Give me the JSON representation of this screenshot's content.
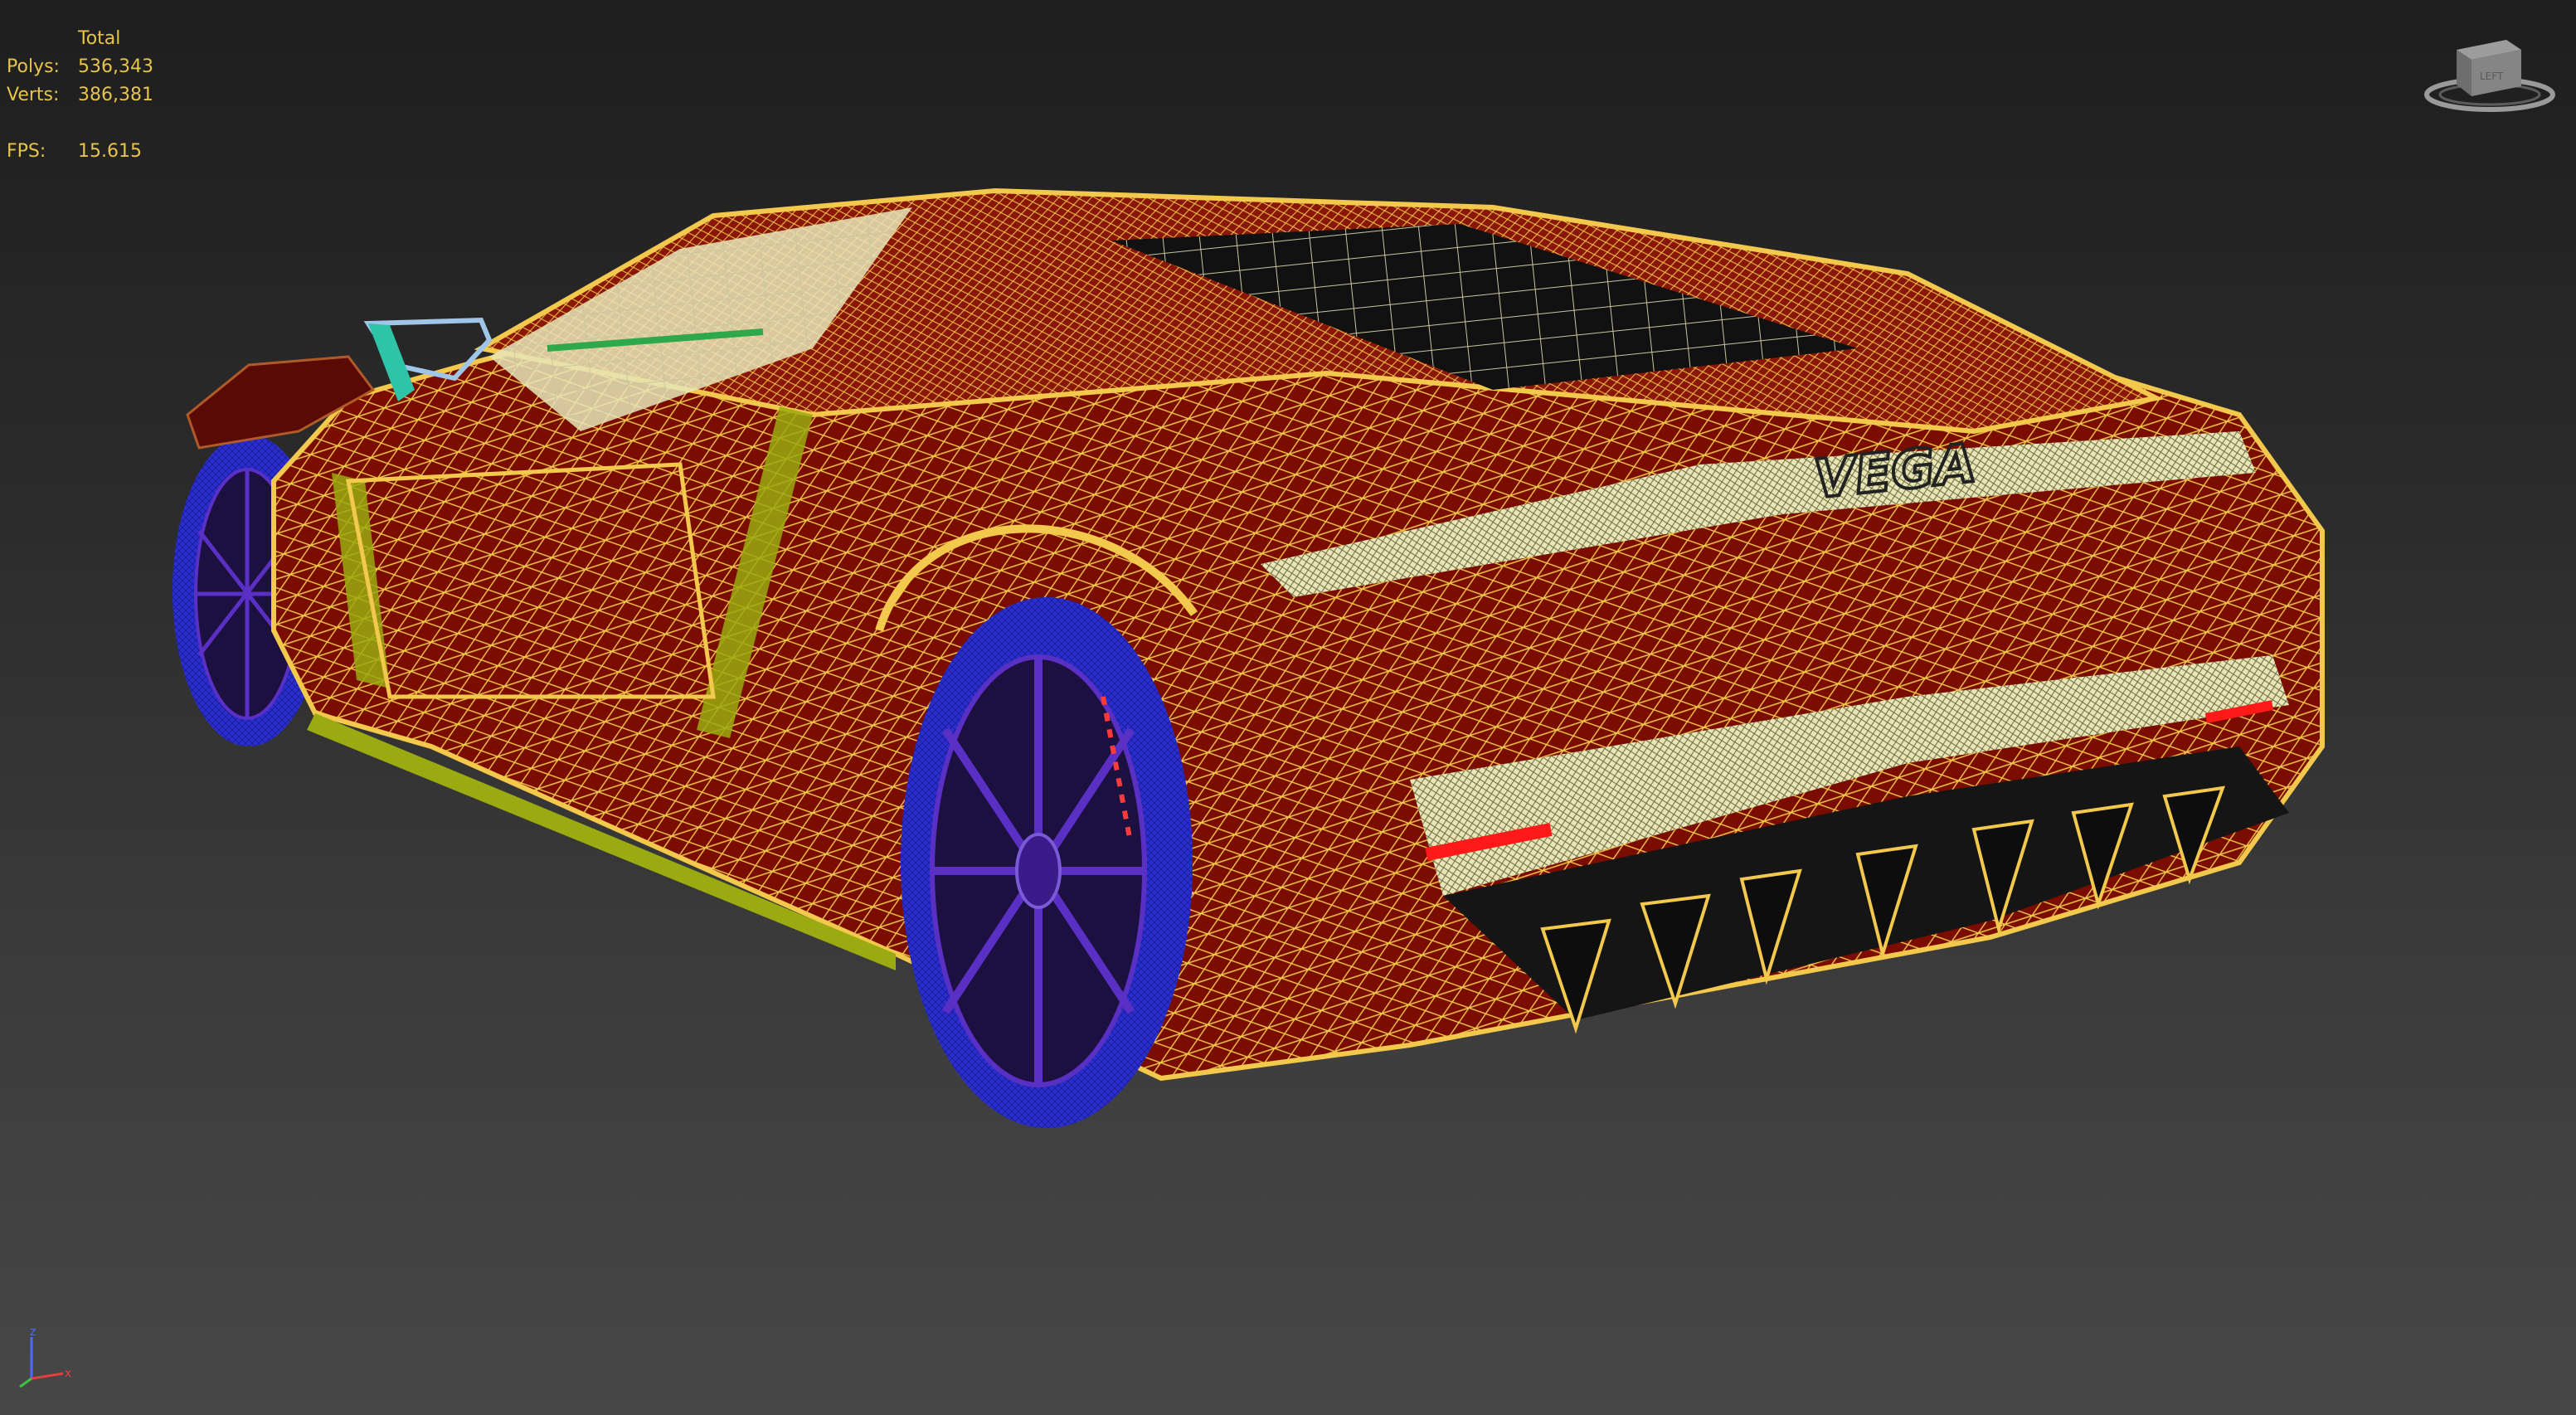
{
  "viewport": {
    "stats": {
      "header": "Total",
      "polys_label": "Polys:",
      "polys_value": "536,343",
      "verts_label": "Verts:",
      "verts_value": "386,381",
      "fps_label": "FPS:",
      "fps_value": "15.615"
    },
    "axis": {
      "z": "z",
      "x": "x"
    },
    "model": {
      "badge": "VEGA",
      "shading": "wireframe-over-shaded",
      "colors": {
        "body": "#7a0c00",
        "wire": "#f2c94c",
        "glass": "#e8e6b8",
        "tire": "#2b2fd0",
        "rim": "#3b1a8a",
        "trim": "#9aaa10",
        "mirror": "#2ec4a8",
        "light": "#ff1a1a"
      }
    },
    "icons": {
      "viewcube": "viewcube-icon",
      "axis": "axis-tripod-icon"
    }
  }
}
